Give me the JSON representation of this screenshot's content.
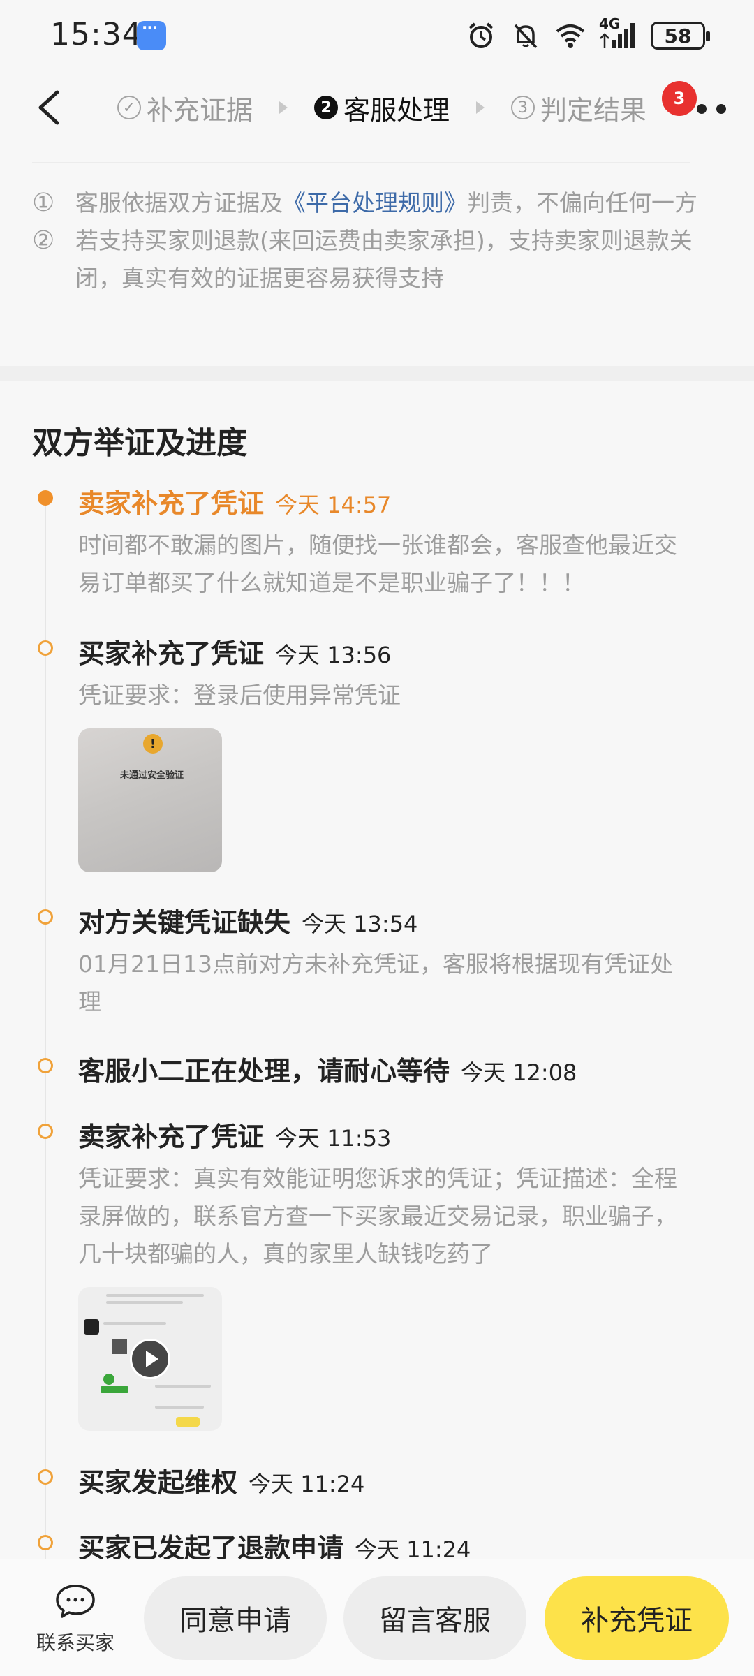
{
  "status_bar": {
    "time": "15:34",
    "icons": [
      "chat-app-icon",
      "alarm-icon",
      "mute-icon",
      "wifi-icon",
      "signal-4g-icon"
    ],
    "network": "4G",
    "battery": "58"
  },
  "nav": {
    "steps": [
      {
        "num": "✓",
        "label": "补充证据",
        "state": "done"
      },
      {
        "num": "2",
        "label": "客服处理",
        "state": "active"
      },
      {
        "num": "3",
        "label": "判定结果",
        "state": "pending"
      }
    ],
    "more_badge": "3"
  },
  "rules": [
    {
      "num": "①",
      "pre": "客服依据双方证据及",
      "link": "《平台处理规则》",
      "post": "判责，不偏向任何一方"
    },
    {
      "num": "②",
      "pre": "若支持买家则退款(来回运费由卖家承担)，支持卖家则退款关闭，真实有效的证据更容易获得支持",
      "link": "",
      "post": ""
    }
  ],
  "section_title": "双方举证及进度",
  "timeline": [
    {
      "title": "卖家补充了凭证",
      "time": "今天 14:57",
      "highlight": true,
      "desc": "时间都不敢漏的图片，随便找一张谁都会，客服查他最近交易订单都买了什么就知道是不是职业骗子了！！！"
    },
    {
      "title": "买家补充了凭证",
      "time": "今天 13:56",
      "highlight": false,
      "desc": "凭证要求：登录后使用异常凭证",
      "image_caption": "未通过安全验证"
    },
    {
      "title": "对方关键凭证缺失",
      "time": "今天 13:54",
      "highlight": false,
      "desc": "01月21日13点前对方未补充凭证，客服将根据现有凭证处理"
    },
    {
      "title": "客服小二正在处理，请耐心等待",
      "time": "今天 12:08",
      "highlight": false,
      "desc": ""
    },
    {
      "title": "卖家补充了凭证",
      "time": "今天 11:53",
      "highlight": false,
      "desc": "凭证要求：真实有效能证明您诉求的凭证；凭证描述：全程录屏做的，联系官方查一下买家最近交易记录，职业骗子，几十块都骗的人，真的家里人缺钱吃药了"
    },
    {
      "title": "买家发起维权",
      "time": "今天 11:24",
      "highlight": false,
      "desc": ""
    },
    {
      "title": "买家已发起了退款申请",
      "time": "今天 11:24",
      "highlight": false,
      "desc": ""
    }
  ],
  "bottom": {
    "contact_label": "联系买家",
    "agree_label": "同意申请",
    "message_label": "留言客服",
    "supplement_label": "补充凭证"
  },
  "colors": {
    "accent_orange": "#e8882a",
    "primary_yellow": "#fde24a",
    "link_blue": "#3d6aa8",
    "badge_red": "#e8312f"
  }
}
